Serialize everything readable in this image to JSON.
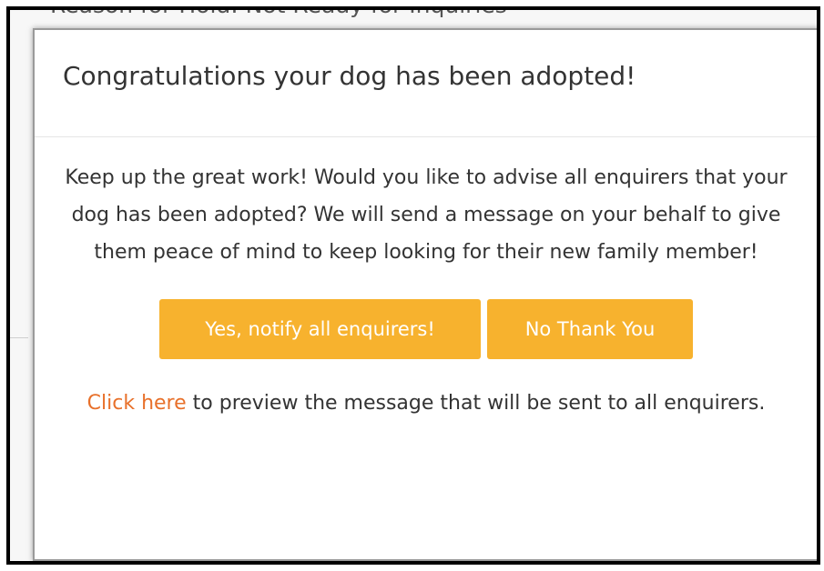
{
  "background": {
    "partial_text": "Reason for Hold: Not Ready for Inquiries"
  },
  "modal": {
    "title": "Congratulations your dog has been adopted!",
    "body": "Keep up the great work! Would you like to advise all enquirers that your dog has been adopted? We will send a message on your behalf to give them peace of mind to keep looking for their new family member!",
    "yes_button_label": "Yes, notify all enquirers!",
    "no_button_label": "No Thank You",
    "preview_link_label": "Click here",
    "preview_suffix": " to preview the message that will be sent to all enquirers."
  },
  "colors": {
    "button_bg": "#f7b22e",
    "button_text": "#ffffff",
    "link": "#e8702a",
    "text": "#333333",
    "frame_border": "#000000"
  }
}
